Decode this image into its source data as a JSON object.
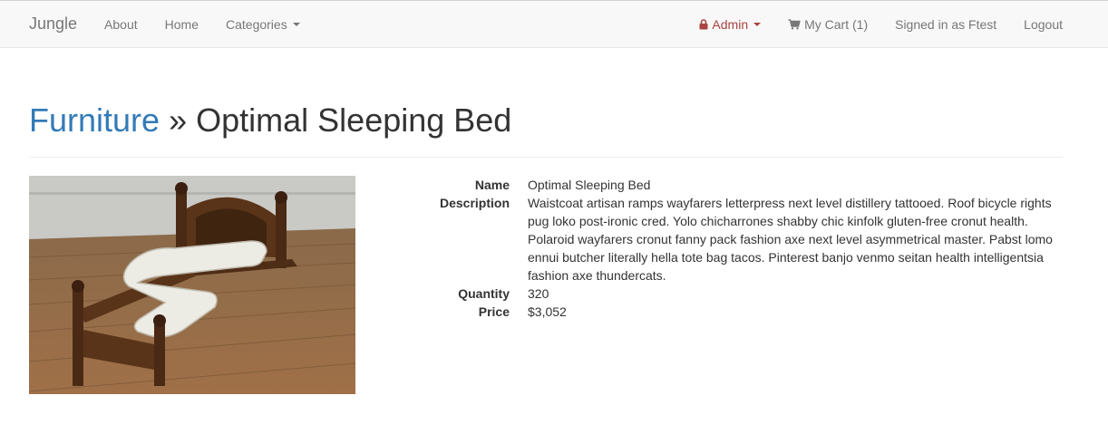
{
  "navbar": {
    "brand": "Jungle",
    "links": [
      "About",
      "Home"
    ],
    "categories_label": "Categories",
    "admin_label": "Admin",
    "cart_label": "My Cart (1)",
    "signed_in_label": "Signed in as Ftest",
    "logout_label": "Logout"
  },
  "header": {
    "category": "Furniture",
    "separator": "»",
    "product_name": "Optimal Sleeping Bed"
  },
  "product": {
    "fields": [
      {
        "label": "Name",
        "value": "Optimal Sleeping Bed"
      },
      {
        "label": "Description",
        "value": "Waistcoat artisan ramps wayfarers letterpress next level distillery tattooed. Roof bicycle rights pug loko post-ironic cred. Yolo chicharrones shabby chic kinfolk gluten-free cronut health. Polaroid wayfarers cronut fanny pack fashion axe next level asymmetrical master. Pabst lomo ennui butcher literally hella tote bag tacos. Pinterest banjo venmo seitan health intelligentsia fashion axe thundercats."
      },
      {
        "label": "Quantity",
        "value": "320"
      },
      {
        "label": "Price",
        "value": "$3,052"
      }
    ]
  },
  "icons": {
    "admin": "lock-icon",
    "cart": "shopping-cart-icon"
  },
  "colors": {
    "link": "#337ab7",
    "admin": "#a94442",
    "nav_text": "#777777",
    "navbar_bg": "#f8f8f8"
  }
}
